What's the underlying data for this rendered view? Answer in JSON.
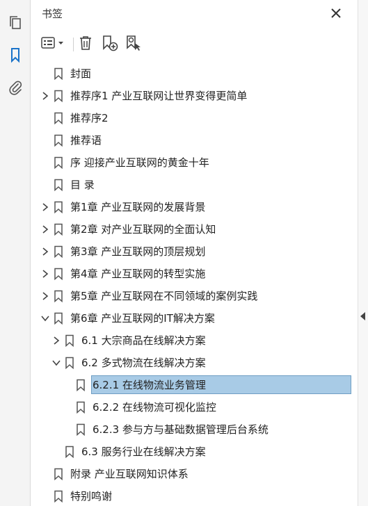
{
  "panel": {
    "title": "书签",
    "items": [
      {
        "label": "封面",
        "level": 0,
        "expander": "none"
      },
      {
        "label": "推荐序1 产业互联网让世界变得更简单",
        "level": 0,
        "expander": "collapsed"
      },
      {
        "label": "推荐序2",
        "level": 0,
        "expander": "none"
      },
      {
        "label": "推荐语",
        "level": 0,
        "expander": "none"
      },
      {
        "label": "序 迎接产业互联网的黄金十年",
        "level": 0,
        "expander": "none"
      },
      {
        "label": "目 录",
        "level": 0,
        "expander": "none"
      },
      {
        "label": "第1章 产业互联网的发展背景",
        "level": 0,
        "expander": "collapsed"
      },
      {
        "label": "第2章 对产业互联网的全面认知",
        "level": 0,
        "expander": "collapsed"
      },
      {
        "label": "第3章 产业互联网的顶层规划",
        "level": 0,
        "expander": "collapsed"
      },
      {
        "label": "第4章 产业互联网的转型实施",
        "level": 0,
        "expander": "collapsed"
      },
      {
        "label": "第5章 产业互联网在不同领域的案例实践",
        "level": 0,
        "expander": "collapsed"
      },
      {
        "label": "第6章 产业互联网的IT解决方案",
        "level": 0,
        "expander": "expanded"
      },
      {
        "label": "6.1 大宗商品在线解决方案",
        "level": 1,
        "expander": "collapsed"
      },
      {
        "label": "6.2 多式物流在线解决方案",
        "level": 1,
        "expander": "expanded"
      },
      {
        "label": "6.2.1 在线物流业务管理",
        "level": 2,
        "expander": "none",
        "selected": true
      },
      {
        "label": "6.2.2 在线物流可视化监控",
        "level": 2,
        "expander": "none"
      },
      {
        "label": "6.2.3 参与方与基础数据管理后台系统",
        "level": 2,
        "expander": "none"
      },
      {
        "label": "6.3 服务行业在线解决方案",
        "level": 1,
        "expander": "none"
      },
      {
        "label": "附录 产业互联网知识体系",
        "level": 0,
        "expander": "none"
      },
      {
        "label": "特别鸣谢",
        "level": 0,
        "expander": "none"
      }
    ]
  },
  "icons": {
    "rail": [
      "pages-icon",
      "bookmark-icon",
      "attachment-icon"
    ],
    "toolbar": [
      "options-menu-icon",
      "delete-icon",
      "add-bookmark-icon",
      "find-bookmark-icon"
    ],
    "close": "close-icon"
  },
  "colors": {
    "selection": "#a8cbe6",
    "selection_border": "#6f9ec3",
    "accent": "#1a73c9"
  }
}
